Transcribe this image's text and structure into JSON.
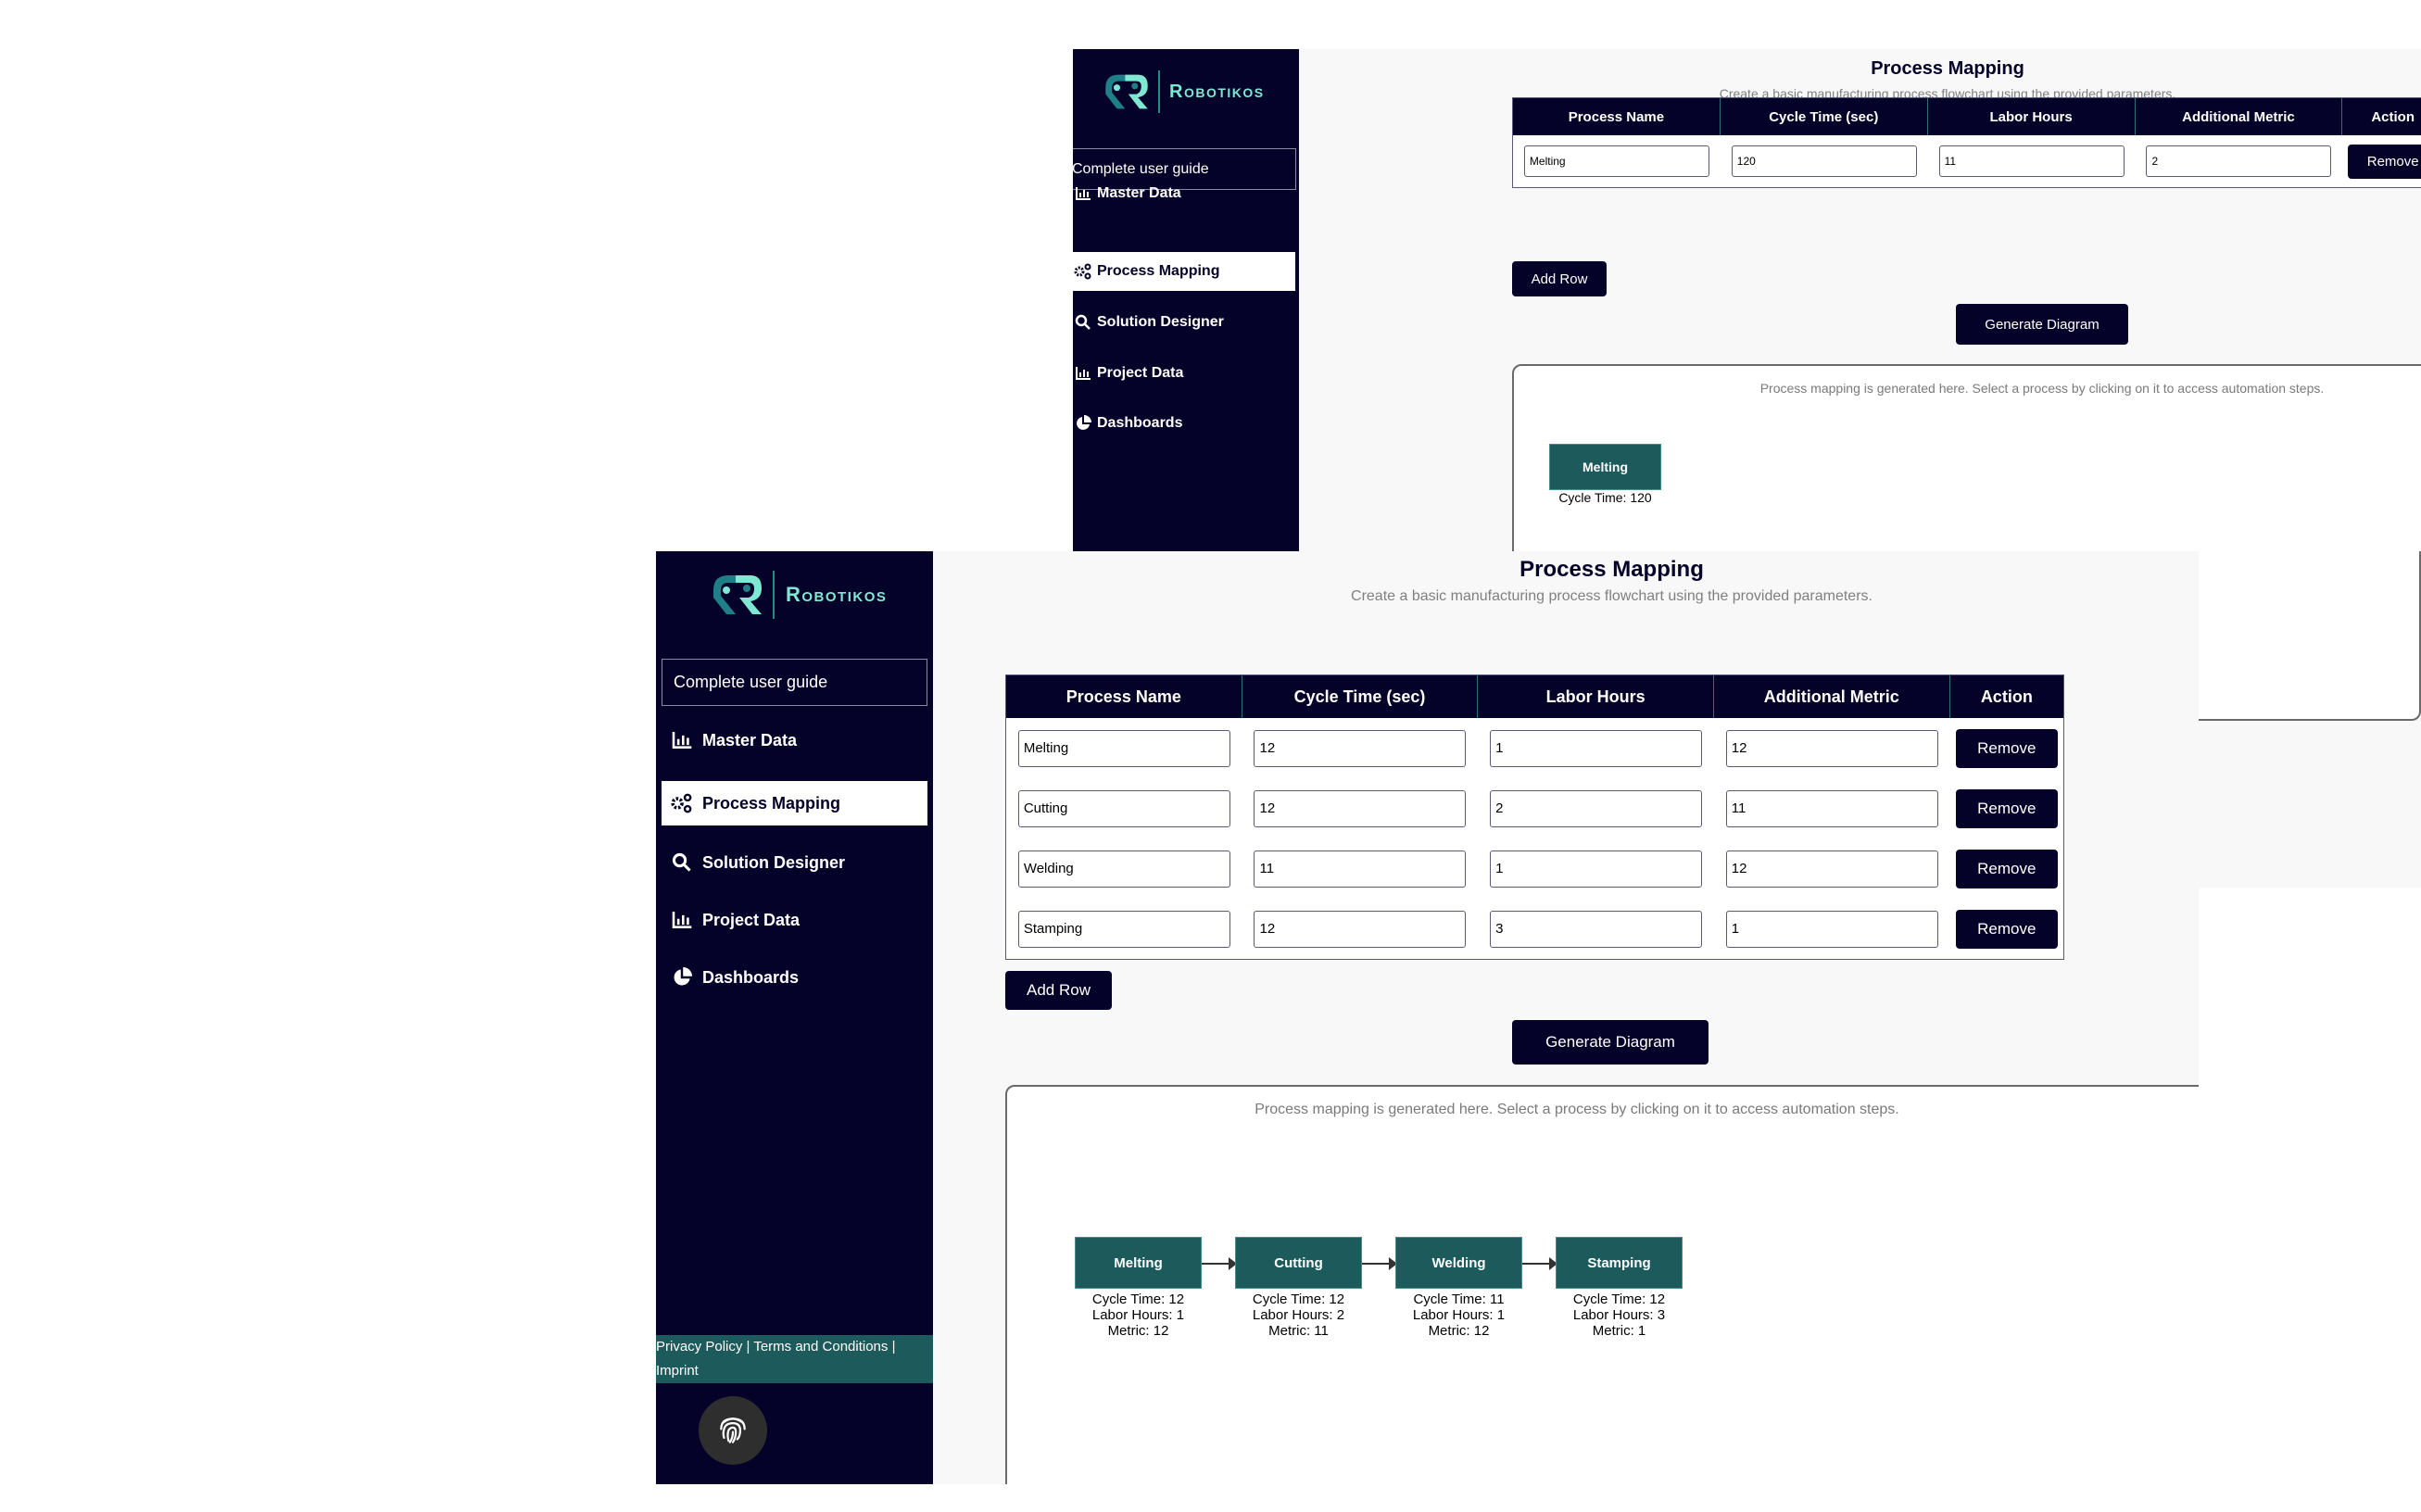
{
  "app": {
    "brand": "Robotikos",
    "guide_link": "Complete user guide",
    "colors": {
      "sidebar_bg": "#05022a",
      "accent": "#1c5a5c",
      "brand_text": "#7ee8d2",
      "page_bg": "#f8f8f8"
    }
  },
  "sidebar": {
    "items": [
      {
        "label": "Master Data",
        "icon": "bar-chart-icon",
        "active": false
      },
      {
        "label": "Process Mapping",
        "icon": "gears-icon",
        "active": true
      },
      {
        "label": "Solution Designer",
        "icon": "search-icon",
        "active": false
      },
      {
        "label": "Project Data",
        "icon": "bar-chart-icon",
        "active": false
      },
      {
        "label": "Dashboards",
        "icon": "pie-chart-icon",
        "active": false
      }
    ],
    "footer": {
      "privacy": "Privacy Policy",
      "terms": "Terms and Conditions",
      "imprint": "Imprint",
      "separator": " | "
    },
    "fingerprint_icon": "fingerprint-icon"
  },
  "page": {
    "title": "Process Mapping",
    "subtitle": "Create a basic manufacturing process flowchart using the provided parameters.",
    "columns": [
      "Process Name",
      "Cycle Time (sec)",
      "Labor Hours",
      "Additional Metric",
      "Action"
    ],
    "remove_label": "Remove",
    "add_row_label": "Add Row",
    "generate_label": "Generate Diagram",
    "diagram_hint": "Process mapping is generated here. Select a process by clicking on it to access automation steps.",
    "cycle_prefix": "Cycle Time: ",
    "labor_prefix": "Labor Hours: ",
    "metric_prefix": "Metric: "
  },
  "back_window": {
    "rows": [
      {
        "name": "Melting",
        "cycle": "120",
        "labor": "11",
        "metric": "2"
      }
    ],
    "diagram_nodes": [
      {
        "name": "Melting",
        "cycle_text": "Cycle Time: 120"
      }
    ]
  },
  "front_window": {
    "rows": [
      {
        "name": "Melting",
        "cycle": "12",
        "labor": "1",
        "metric": "12"
      },
      {
        "name": "Cutting",
        "cycle": "12",
        "labor": "2",
        "metric": "11"
      },
      {
        "name": "Welding",
        "cycle": "11",
        "labor": "1",
        "metric": "12"
      },
      {
        "name": "Stamping",
        "cycle": "12",
        "labor": "3",
        "metric": "1"
      }
    ],
    "diagram_nodes": [
      {
        "name": "Melting",
        "cycle": "Cycle Time: 12",
        "labor": "Labor Hours: 1",
        "metric": "Metric: 12"
      },
      {
        "name": "Cutting",
        "cycle": "Cycle Time: 12",
        "labor": "Labor Hours: 2",
        "metric": "Metric: 11"
      },
      {
        "name": "Welding",
        "cycle": "Cycle Time: 11",
        "labor": "Labor Hours: 1",
        "metric": "Metric: 12"
      },
      {
        "name": "Stamping",
        "cycle": "Cycle Time: 12",
        "labor": "Labor Hours: 3",
        "metric": "Metric: 1"
      }
    ]
  }
}
